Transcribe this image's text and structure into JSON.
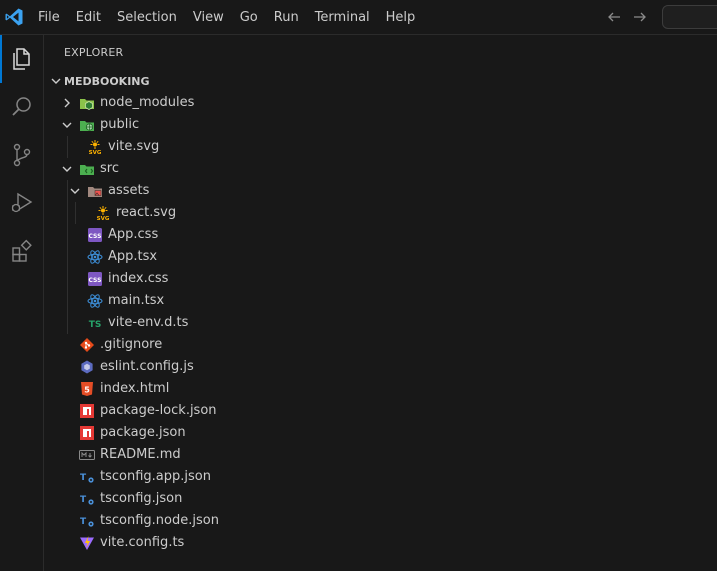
{
  "menu": [
    "File",
    "Edit",
    "Selection",
    "View",
    "Go",
    "Run",
    "Terminal",
    "Help"
  ],
  "explorer": {
    "title": "EXPLORER",
    "project": "MEDBOOKING"
  },
  "tree": [
    {
      "label": "node_modules",
      "icon": "folder-node-icon",
      "type": "folder",
      "open": false
    },
    {
      "label": "public",
      "icon": "folder-public-icon",
      "type": "folder",
      "open": true
    },
    {
      "label": "vite.svg",
      "icon": "svg-file-icon",
      "type": "file"
    },
    {
      "label": "src",
      "icon": "folder-src-icon",
      "type": "folder",
      "open": true
    },
    {
      "label": "assets",
      "icon": "folder-assets-icon",
      "type": "folder",
      "open": true
    },
    {
      "label": "react.svg",
      "icon": "svg-file-icon",
      "type": "file"
    },
    {
      "label": "App.css",
      "icon": "css-file-icon",
      "type": "file"
    },
    {
      "label": "App.tsx",
      "icon": "react-file-icon",
      "type": "file"
    },
    {
      "label": "index.css",
      "icon": "css-file-icon",
      "type": "file"
    },
    {
      "label": "main.tsx",
      "icon": "react-file-icon",
      "type": "file"
    },
    {
      "label": "vite-env.d.ts",
      "icon": "typescript-def-file-icon",
      "type": "file"
    },
    {
      "label": ".gitignore",
      "icon": "git-file-icon",
      "type": "file"
    },
    {
      "label": "eslint.config.js",
      "icon": "eslint-file-icon",
      "type": "file"
    },
    {
      "label": "index.html",
      "icon": "html-file-icon",
      "type": "file"
    },
    {
      "label": "package-lock.json",
      "icon": "npm-file-icon",
      "type": "file"
    },
    {
      "label": "package.json",
      "icon": "npm-file-icon",
      "type": "file"
    },
    {
      "label": "README.md",
      "icon": "markdown-file-icon",
      "type": "file"
    },
    {
      "label": "tsconfig.app.json",
      "icon": "tsconfig-file-icon",
      "type": "file"
    },
    {
      "label": "tsconfig.json",
      "icon": "tsconfig-file-icon",
      "type": "file"
    },
    {
      "label": "tsconfig.node.json",
      "icon": "tsconfig-file-icon",
      "type": "file"
    },
    {
      "label": "vite.config.ts",
      "icon": "vite-file-icon",
      "type": "file"
    }
  ],
  "colors": {
    "background": "#181818",
    "accent": "#0078d4",
    "text": "#cccccc"
  }
}
